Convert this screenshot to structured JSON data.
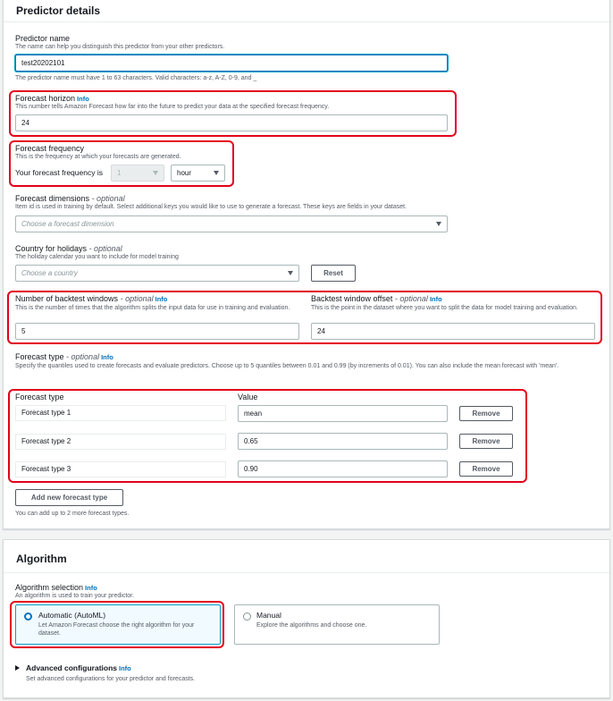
{
  "predictor": {
    "title": "Predictor details",
    "name_label": "Predictor name",
    "name_desc": "The name can help you distinguish this predictor from your other predictors.",
    "name_value": "test20202101",
    "name_hint": "The predictor name must have 1 to 63 characters. Valid characters: a-z, A-Z, 0-9, and _",
    "horizon_label": "Forecast horizon",
    "horizon_info": "Info",
    "horizon_desc": "This number tells Amazon Forecast how far into the future to predict your data at the specified forecast frequency.",
    "horizon_value": "24",
    "freq_label": "Forecast frequency",
    "freq_desc": "This is the frequency at which your forecasts are generated.",
    "freq_prefix": "Your forecast frequency is",
    "freq_number": "1",
    "freq_unit": "hour",
    "dims_label": "Forecast dimensions",
    "dims_optional": "- optional",
    "dims_desc": "Item id is used in training by default. Select additional keys you would like to use to generate a forecast. These keys are fields in your dataset.",
    "dims_placeholder": "Choose a forecast dimension",
    "country_label": "Country for holidays",
    "country_optional": "- optional",
    "country_desc": "The holiday calendar you want to include for model training",
    "country_placeholder": "Choose a country",
    "reset_label": "Reset",
    "backtest_label": "Number of backtest windows",
    "backtest_optional": "- optional",
    "backtest_info": "Info",
    "backtest_desc": "This is the number of times that the algorithm splits the input data for use in training and evaluation.",
    "backtest_value": "5",
    "offset_label": "Backtest window offset",
    "offset_optional": "- optional",
    "offset_info": "Info",
    "offset_desc": "This is the point in the dataset where you want to split the data for model training and evaluation.",
    "offset_value": "24",
    "ftype_label": "Forecast type",
    "ftype_optional": "- optional",
    "ftype_info": "Info",
    "ftype_desc": "Specify the quantiles used to create forecasts and evaluate predictors. Choose up to 5 quantiles between 0.01 and 0.99 (by increments of 0.01). You can also include the mean forecast with 'mean'.",
    "col_type": "Forecast type",
    "col_value": "Value",
    "rows": [
      {
        "type": "Forecast type 1",
        "value": "mean",
        "remove": "Remove"
      },
      {
        "type": "Forecast type 2",
        "value": "0.65",
        "remove": "Remove"
      },
      {
        "type": "Forecast type 3",
        "value": "0.90",
        "remove": "Remove"
      }
    ],
    "add_label": "Add new forecast type",
    "add_hint": "You can add up to 2 more forecast types."
  },
  "algorithm": {
    "title": "Algorithm",
    "selection_label": "Algorithm selection",
    "selection_info": "Info",
    "selection_desc": "An algorithm is used to train your predictor.",
    "auto_title": "Automatic (AutoML)",
    "auto_desc": "Let Amazon Forecast choose the right algorithm for your dataset.",
    "manual_title": "Manual",
    "manual_desc": "Explore the algorithms and choose one.",
    "advanced_label": "Advanced configurations",
    "advanced_info": "Info",
    "advanced_desc": "Set advanced configurations for your predictor and forecasts."
  },
  "colors": {
    "accent": "#0073bb",
    "highlight": "#e3001b",
    "border": "#aab7b8"
  }
}
